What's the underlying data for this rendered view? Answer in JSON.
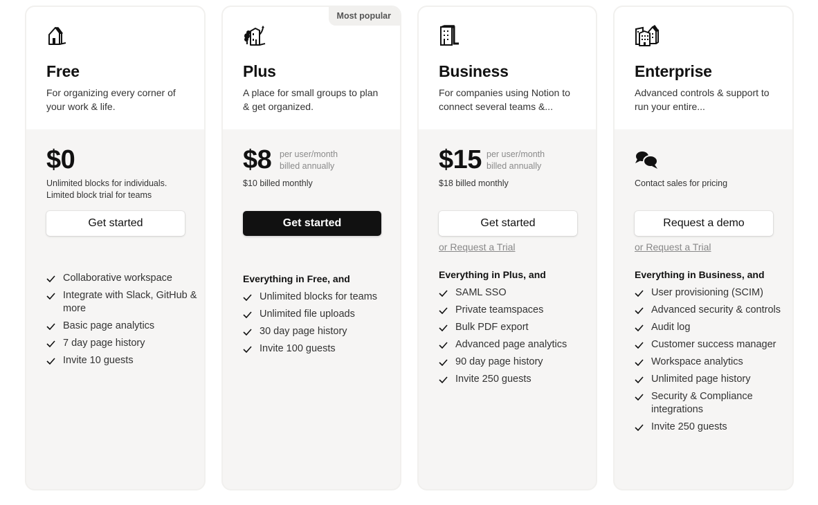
{
  "plans": [
    {
      "name": "Free",
      "icon": "house-icon",
      "description": "For organizing every corner of your work & life.",
      "price": "$0",
      "price_note": [],
      "subprice": "Unlimited blocks for individuals. Limited block trial for teams",
      "cta_label": "Get started",
      "cta_style": "light",
      "trial_link": null,
      "features_heading": null,
      "features": [
        "Collaborative workspace",
        "Integrate with Slack, GitHub & more",
        "Basic page analytics",
        "7 day page history",
        "Invite 10 guests"
      ]
    },
    {
      "name": "Plus",
      "icon": "small-building-with-tree-icon",
      "badge": "Most popular",
      "description": "A place for small groups to plan & get organized.",
      "price": "$8",
      "price_note": [
        "per user/month",
        "billed annually"
      ],
      "subprice": "$10 billed monthly",
      "cta_label": "Get started",
      "cta_style": "dark",
      "trial_link": null,
      "features_heading": "Everything in Free, and",
      "features": [
        "Unlimited blocks for teams",
        "Unlimited file uploads",
        "30 day page history",
        "Invite 100 guests"
      ]
    },
    {
      "name": "Business",
      "icon": "office-building-icon",
      "description": "For companies using Notion to connect several teams &...",
      "price": "$15",
      "price_note": [
        "per user/month",
        "billed annually"
      ],
      "subprice": "$18 billed monthly",
      "cta_label": "Get started",
      "cta_style": "light",
      "trial_link": "or Request a Trial",
      "features_heading": "Everything in Plus, and",
      "features": [
        "SAML SSO",
        "Private teamspaces",
        "Bulk PDF export",
        "Advanced page analytics",
        "90 day page history",
        "Invite 250 guests"
      ]
    },
    {
      "name": "Enterprise",
      "icon": "city-buildings-icon",
      "description": "Advanced controls & support to run your entire...",
      "price": null,
      "price_icon": "chat-bubbles-icon",
      "price_note": [],
      "subprice": "Contact sales for pricing",
      "cta_label": "Request a demo",
      "cta_style": "light",
      "trial_link": "or Request a Trial",
      "features_heading": "Everything in Business, and",
      "features": [
        "User provisioning (SCIM)",
        "Advanced security & controls",
        "Audit log",
        "Customer success manager",
        "Workspace analytics",
        "Unlimited page history",
        "Security & Compliance integrations",
        "Invite 250 guests"
      ]
    }
  ]
}
